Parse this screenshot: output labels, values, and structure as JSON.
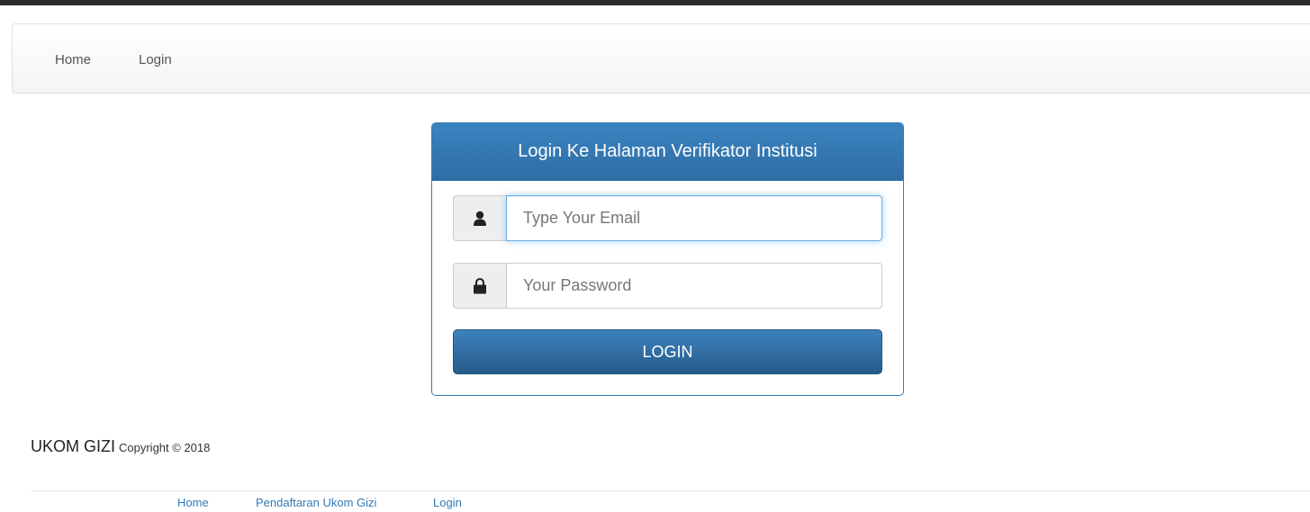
{
  "navbar": {
    "items": [
      {
        "label": "Home"
      },
      {
        "label": "Login"
      }
    ]
  },
  "login_panel": {
    "title": "Login Ke Halaman Verifikator Institusi",
    "email": {
      "placeholder": "Type Your Email",
      "value": "",
      "icon": "user-icon"
    },
    "password": {
      "placeholder": "Your Password",
      "value": "",
      "icon": "lock-icon"
    },
    "submit_label": "LOGIN"
  },
  "footer": {
    "brand": "UKOM GIZI",
    "copyright": "Copyright © 2018",
    "links": [
      {
        "label": "Home"
      },
      {
        "label": "Pendaftaran Ukom Gizi"
      },
      {
        "label": "Login"
      }
    ]
  },
  "colors": {
    "primary": "#337ab7",
    "heading_gradient_top": "#3b83c0",
    "heading_gradient_bottom": "#2e6da4",
    "focus_border": "#66afe9"
  }
}
